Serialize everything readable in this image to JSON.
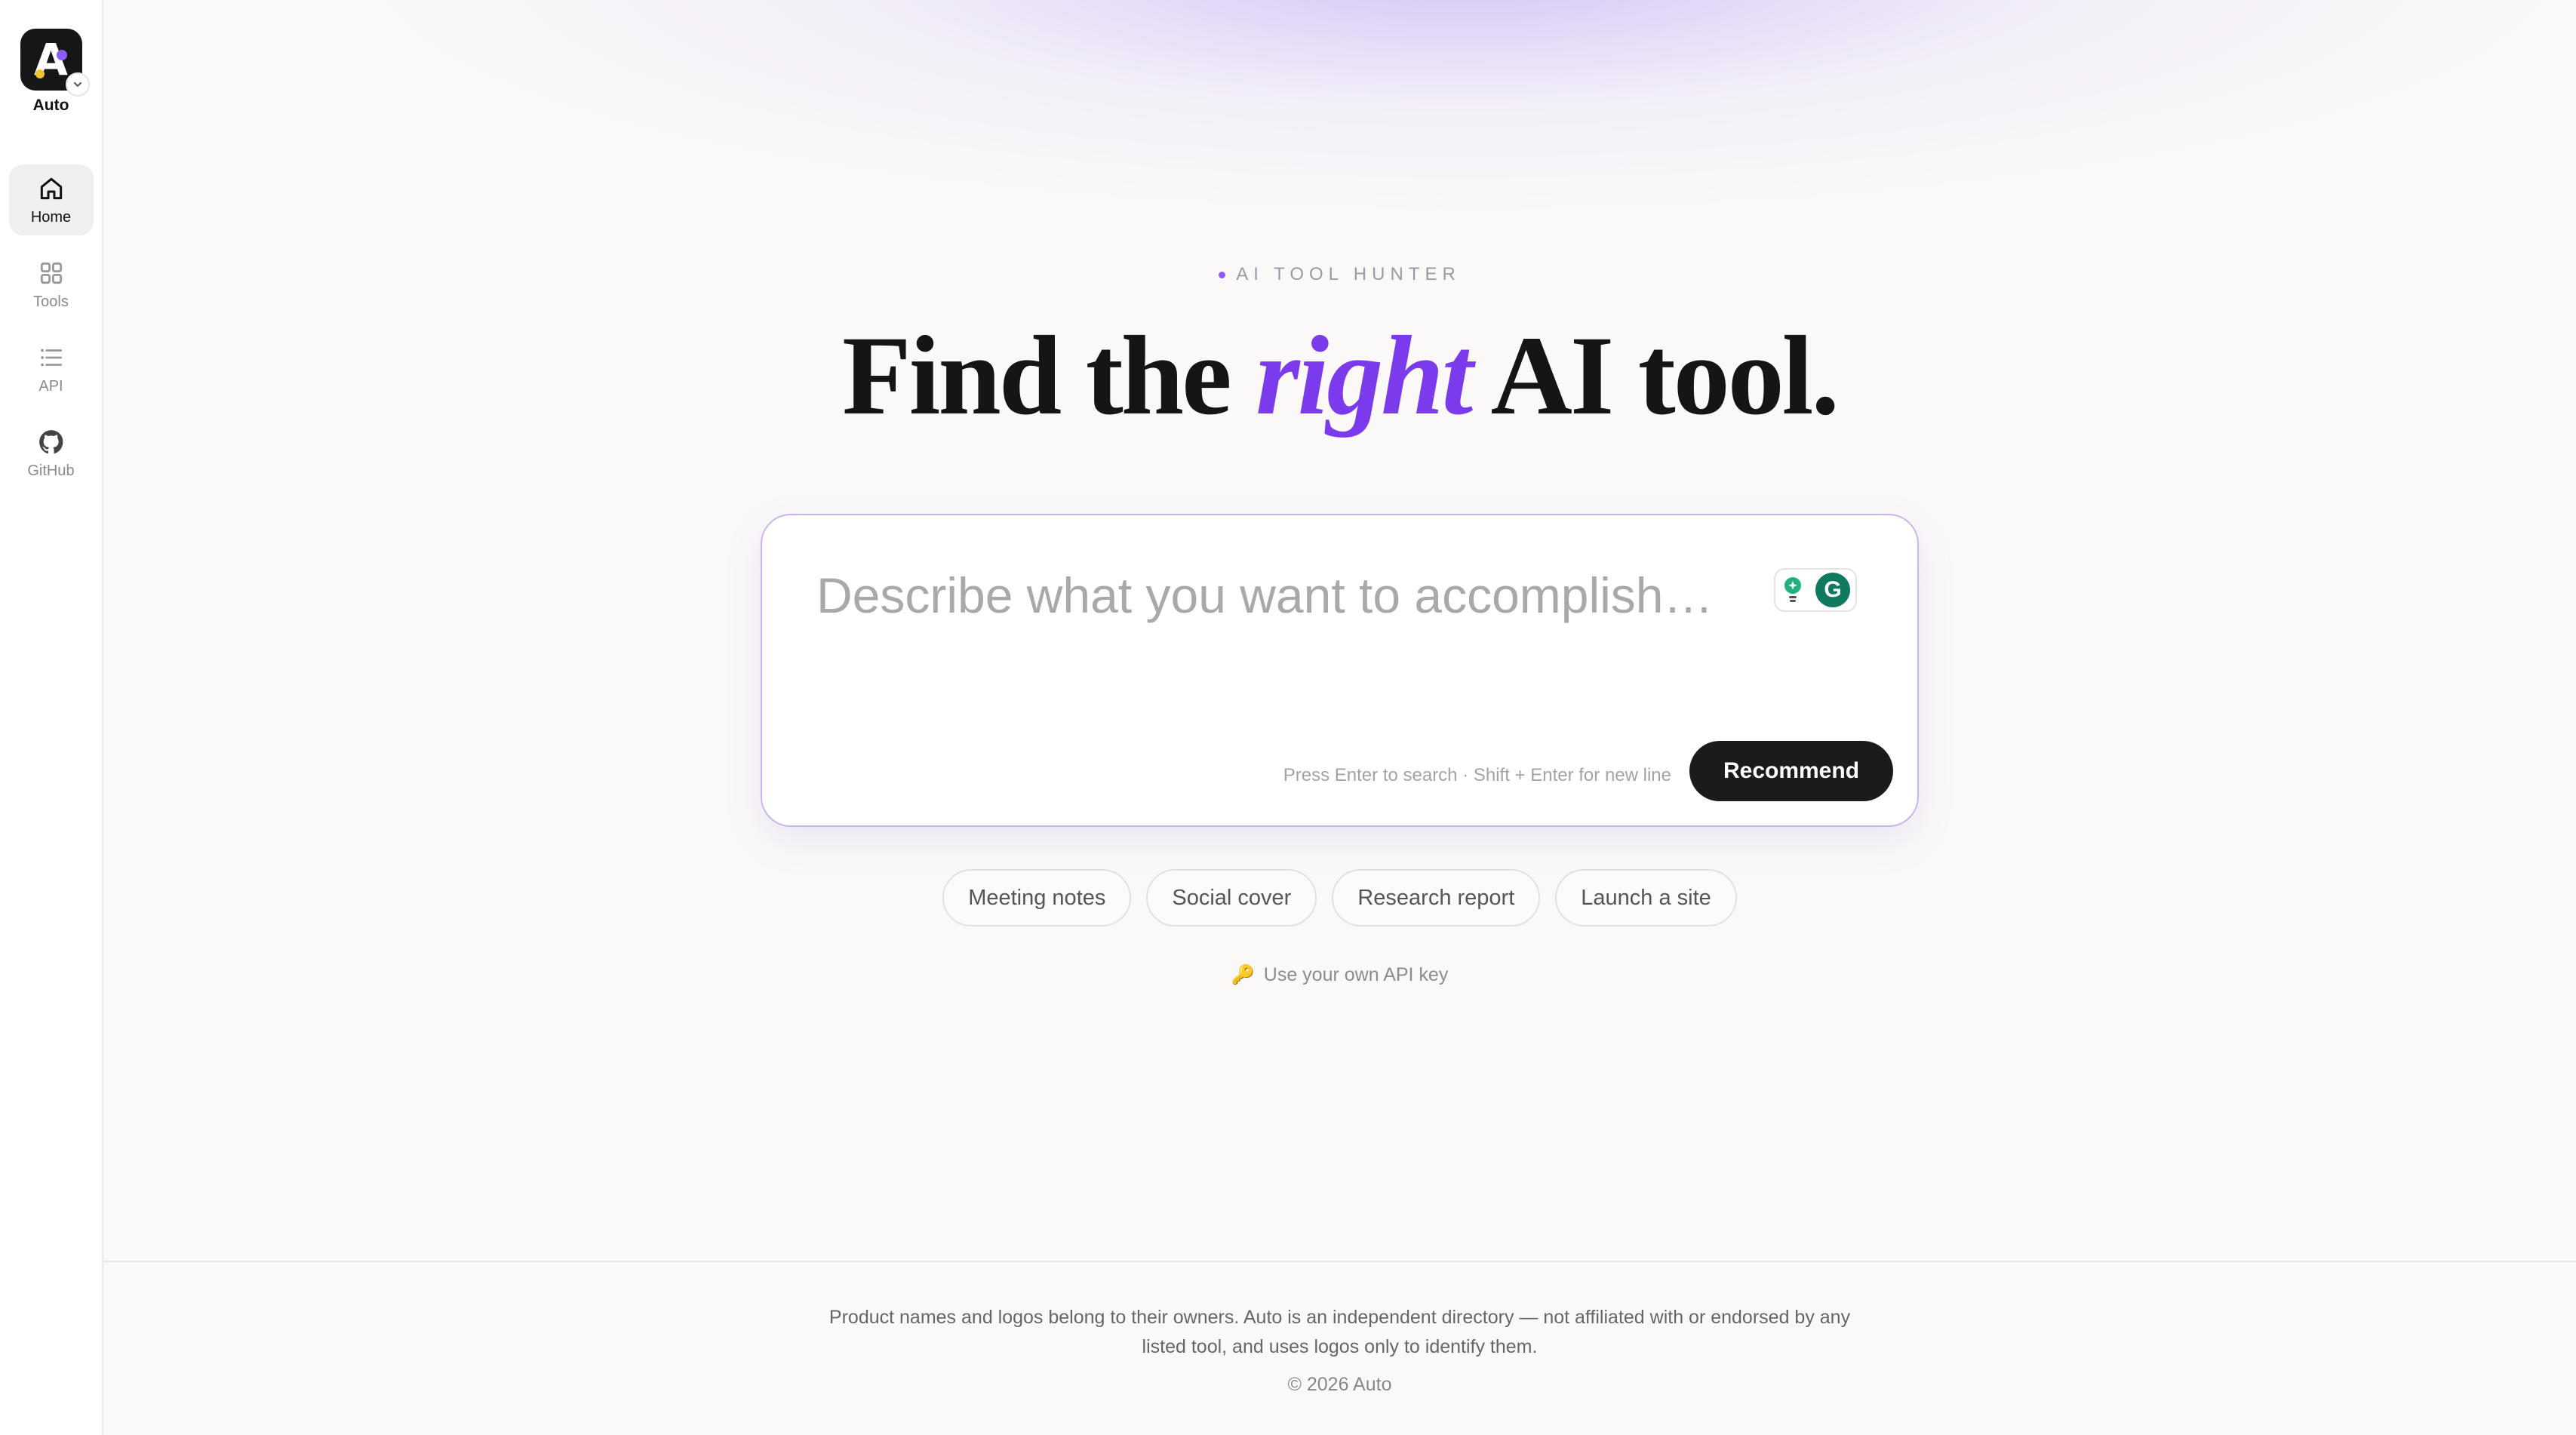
{
  "brand": {
    "name": "Auto",
    "logo_letter": "A"
  },
  "sidebar": {
    "items": [
      {
        "label": "Home",
        "icon": "home-icon",
        "active": true
      },
      {
        "label": "Tools",
        "icon": "grid-icon",
        "active": false
      },
      {
        "label": "API",
        "icon": "list-icon",
        "active": false
      },
      {
        "label": "GitHub",
        "icon": "github-icon",
        "active": false
      }
    ]
  },
  "hero": {
    "eyebrow": "AI TOOL HUNTER",
    "title_before": "Find the ",
    "title_accent": "right",
    "title_after": " AI tool."
  },
  "search": {
    "placeholder": "Describe what you want to accomplish…",
    "value": "",
    "hint": "Press Enter to search · Shift + Enter for new line",
    "button_label": "Recommend",
    "extension_badge": "G"
  },
  "chips": [
    "Meeting notes",
    "Social cover",
    "Research report",
    "Launch a site"
  ],
  "api_key_link": {
    "icon": "🔑",
    "label": "Use your own API key"
  },
  "footer": {
    "disclaimer": "Product names and logos belong to their owners. Auto is an independent directory — not affiliated with or endorsed by any listed tool, and uses logos only to identify them.",
    "copyright": "© 2026 Auto"
  },
  "colors": {
    "accent": "#7c3aed",
    "button_bg": "#1b1b1b",
    "card_border": "#c9b4f2",
    "background": "#faf9f8"
  }
}
